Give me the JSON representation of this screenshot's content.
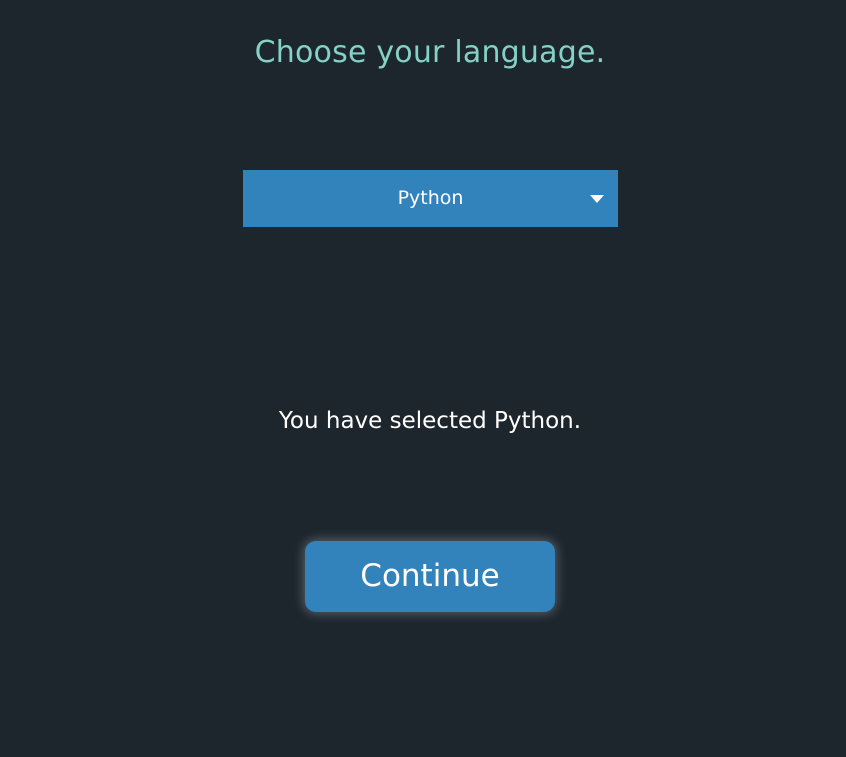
{
  "heading": "Choose your language.",
  "language_select": {
    "selected": "Python",
    "icon": "caret-down-icon"
  },
  "selection_message": "You have selected Python.",
  "continue_button": {
    "label": "Continue"
  },
  "colors": {
    "background": "#1d262d",
    "heading": "#84d1c5",
    "accent": "#3282bc",
    "text": "#ffffff"
  }
}
